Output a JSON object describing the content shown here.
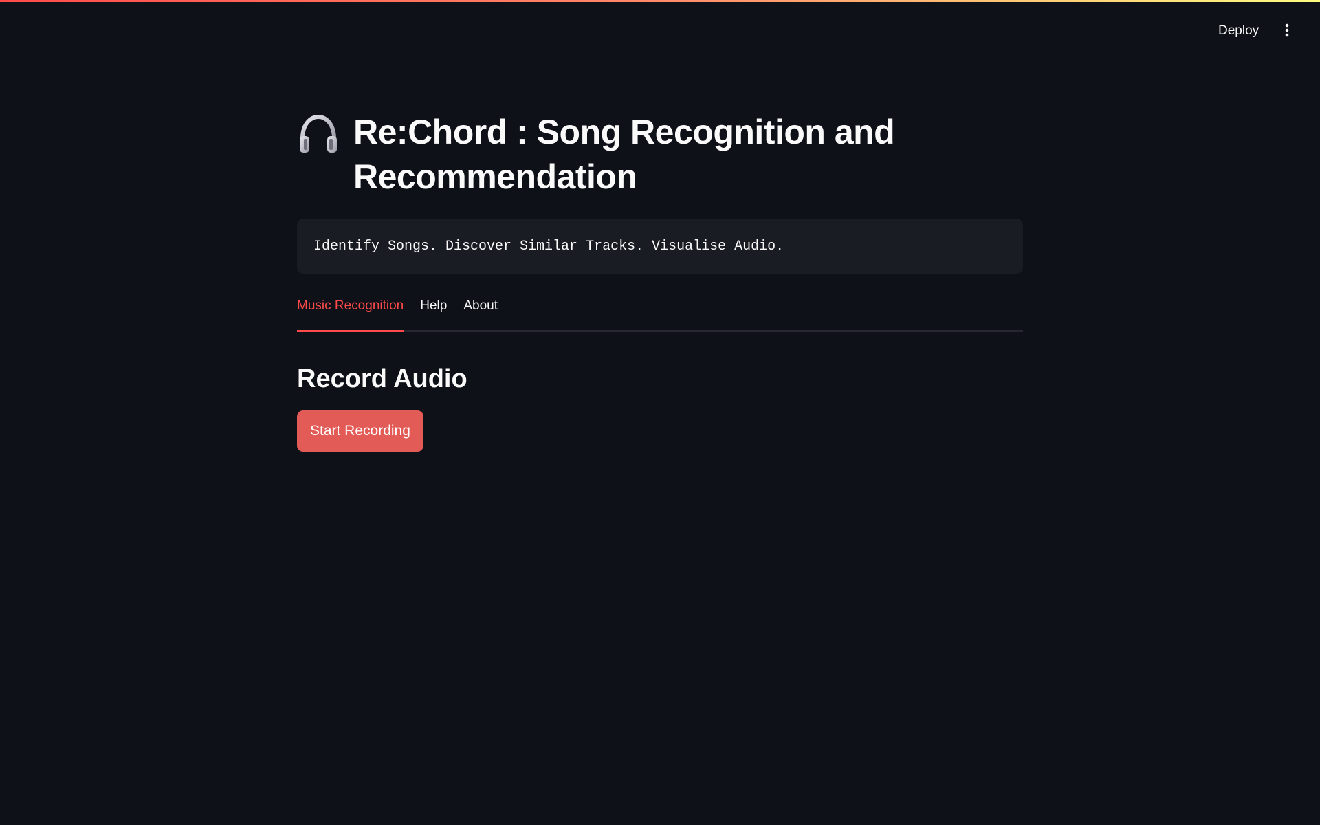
{
  "header": {
    "deploy_label": "Deploy",
    "menu_icon": "more-vertical-icon"
  },
  "main": {
    "title_icon": "headphones-icon",
    "title": "Re:Chord : Song Recognition and Recommendation",
    "tagline": "Identify Songs. Discover Similar Tracks. Visualise Audio.",
    "tabs": [
      {
        "label": "Music Recognition",
        "active": true
      },
      {
        "label": "Help",
        "active": false
      },
      {
        "label": "About",
        "active": false
      }
    ],
    "section_title": "Record Audio",
    "record_button_label": "Start Recording"
  },
  "colors": {
    "background": "#0e1117",
    "accent": "#ff4b4b",
    "button": "#e35b57",
    "code_bg": "#1a1c24",
    "text": "#fafafa"
  }
}
